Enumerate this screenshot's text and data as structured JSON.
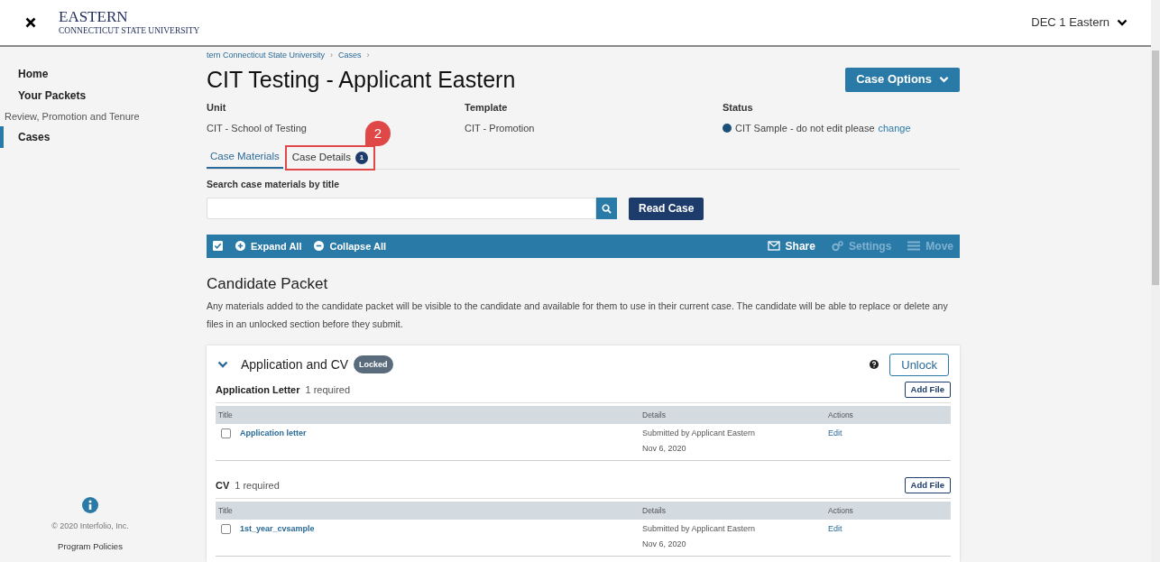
{
  "header": {
    "logo_title": "EASTERN",
    "logo_subtitle": "CONNECTICUT STATE UNIVERSITY",
    "user_menu": "DEC 1 Eastern"
  },
  "sidebar": {
    "items": [
      {
        "label": "Home",
        "kind": "link",
        "selected": false
      },
      {
        "label": "Your Packets",
        "kind": "link",
        "selected": false
      },
      {
        "label": "Review, Promotion and Tenure",
        "kind": "heading"
      },
      {
        "label": "Cases",
        "kind": "link",
        "selected": true
      }
    ],
    "copyright": "© 2020 Interfolio, Inc.",
    "policies": "Program Policies"
  },
  "breadcrumb": [
    {
      "label": "tern Connecticut State University",
      "separator": "›"
    },
    {
      "label": "Cases",
      "separator": "›"
    }
  ],
  "title": "CIT Testing - Applicant Eastern",
  "case_options": "Case Options",
  "meta": [
    {
      "label": "Unit",
      "value": "CIT - School of Testing"
    },
    {
      "label": "Template",
      "value": "CIT - Promotion"
    },
    {
      "label": "Status",
      "value": "CIT Sample - do not edit please",
      "link": "change",
      "color": "#1a4f7a"
    }
  ],
  "tabs": [
    {
      "label": "Case Materials",
      "selected": true,
      "highlighted": false
    },
    {
      "label": "Case Details",
      "badge": "1",
      "selected": false,
      "highlighted": true
    }
  ],
  "callout": "2",
  "search": {
    "label": "Search case materials by title"
  },
  "read_case": "Read Case",
  "toolbar": {
    "left": [
      {
        "label": "Expand All",
        "kind": "expand"
      },
      {
        "label": "Collapse All",
        "kind": "collapse"
      }
    ],
    "right": [
      {
        "label": "Share",
        "kind": "share",
        "disabled": false
      },
      {
        "label": "Settings",
        "kind": "settings",
        "disabled": true
      },
      {
        "label": "Move",
        "kind": "move",
        "disabled": true
      }
    ]
  },
  "packet": {
    "title": "Candidate Packet",
    "description": "Any materials added to the candidate packet will be visible to the candidate and available for them to use in their current case. The candidate will be able to replace or delete any files in an unlocked section before they submit."
  },
  "section": {
    "title": "Application and CV",
    "badge": "Locked",
    "expanded": true,
    "unlock": "Unlock",
    "groups": [
      {
        "name": "Application Letter",
        "required": "1 required",
        "add": "Add File",
        "columns": [
          "Title",
          "Details",
          "Actions"
        ],
        "rows": [
          {
            "title": "Application letter",
            "checked": false,
            "details": "Submitted by Applicant Eastern",
            "date": "Nov 6, 2020",
            "action": "Edit"
          }
        ]
      },
      {
        "name": "CV",
        "required": "1 required",
        "add": "Add File",
        "columns": [
          "Title",
          "Details",
          "Actions"
        ],
        "rows": [
          {
            "title": "1st_year_cvsample",
            "checked": false,
            "details": "Submitted by Applicant Eastern",
            "date": "Nov 6, 2020",
            "action": "Edit"
          }
        ]
      }
    ]
  }
}
